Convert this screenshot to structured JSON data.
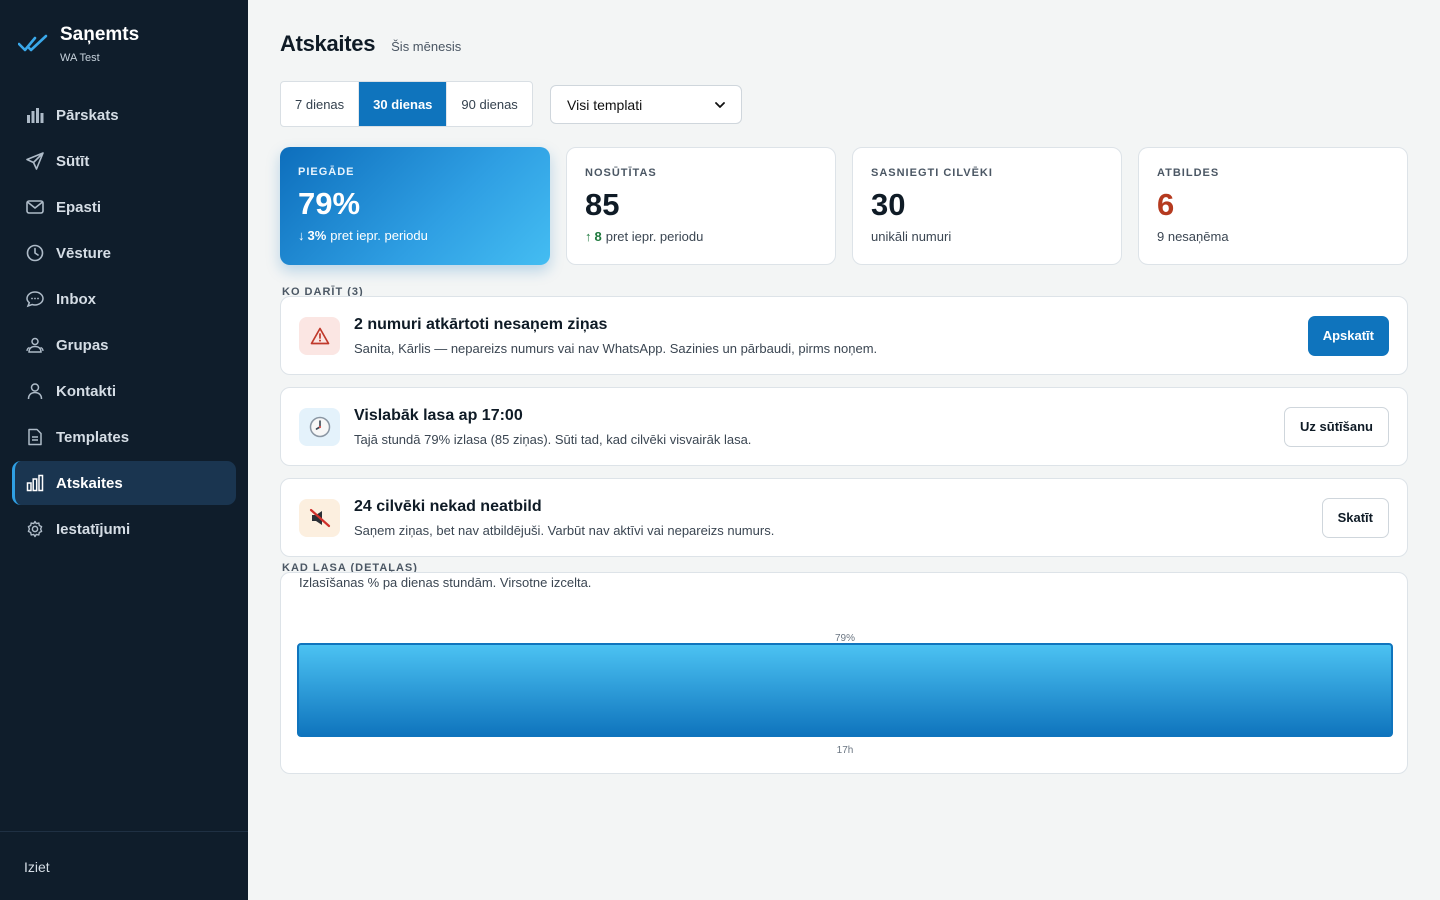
{
  "brand": {
    "name": "Saņemts",
    "subtitle": "WA Test"
  },
  "nav": {
    "items": [
      {
        "label": "Pārskats",
        "icon": "bar-chart-icon"
      },
      {
        "label": "Sūtīt",
        "icon": "send-icon"
      },
      {
        "label": "Epasti",
        "icon": "mail-icon"
      },
      {
        "label": "Vēsture",
        "icon": "clock-icon"
      },
      {
        "label": "Inbox",
        "icon": "chat-icon"
      },
      {
        "label": "Grupas",
        "icon": "group-icon"
      },
      {
        "label": "Kontakti",
        "icon": "user-icon"
      },
      {
        "label": "Templates",
        "icon": "document-icon"
      },
      {
        "label": "Atskaites",
        "icon": "report-icon",
        "active": true
      },
      {
        "label": "Iestatījumi",
        "icon": "gear-icon"
      }
    ],
    "logout": "Iziet"
  },
  "header": {
    "title": "Atskaites",
    "subtitle": "Šis mēnesis"
  },
  "range": {
    "options": [
      "7 dienas",
      "30 dienas",
      "90 dienas"
    ],
    "selected": "30 dienas"
  },
  "template_select": {
    "value": "Visi templati"
  },
  "stats": {
    "delivery": {
      "label": "PIEGĀDE",
      "value": "79%",
      "delta": "3%",
      "note": "pret iepr. periodu",
      "direction": "down"
    },
    "sent": {
      "label": "NOSŪTĪTAS",
      "value": "85",
      "delta": "8",
      "note": "pret iepr. periodu",
      "direction": "up"
    },
    "reached": {
      "label": "SASNIEGTI CILVĒKI",
      "value": "30",
      "note": "unikāli numuri"
    },
    "replies": {
      "label": "ATBILDES",
      "value": "6",
      "note": "9 nesaņēma"
    }
  },
  "todo": {
    "label": "KO DARĪT (3)",
    "cards": [
      {
        "icon": "warning-icon",
        "title": "2 numuri atkārtoti nesaņem ziņas",
        "desc": "Sanita, Kārlis — nepareizs numurs vai nav WhatsApp. Sazinies un pārbaudi, pirms noņem.",
        "button": "Apskatīt"
      },
      {
        "icon": "clock-icon",
        "title": "Vislabāk lasa ap 17:00",
        "desc": "Tajā stundā 79% izlasa (85 ziņas). Sūti tad, kad cilvēki visvairāk lasa.",
        "button": "Uz sūtīšanu"
      },
      {
        "icon": "muted-speaker-icon",
        "title": "24 cilvēki nekad neatbild",
        "desc": "Saņem ziņas, bet nav atbildējuši. Varbūt nav aktīvi vai nepareizs numurs.",
        "button": "Skatīt"
      }
    ]
  },
  "read_times": {
    "label": "KAD LASA (DETAĻAS)",
    "caption": "Izlasīšanas % pa dienas stundām. Virsotne izcelta."
  },
  "chart_data": {
    "type": "bar",
    "categories": [
      "17h"
    ],
    "values": [
      79
    ],
    "value_labels": [
      "79%"
    ],
    "highlight": "17h",
    "ylim": [
      0,
      79
    ],
    "grid": false
  },
  "colors": {
    "accent": "#0f74bd",
    "sidebar": "#0f1d2b",
    "danger": "#b53a1f",
    "positive": "#1f7a3e"
  }
}
